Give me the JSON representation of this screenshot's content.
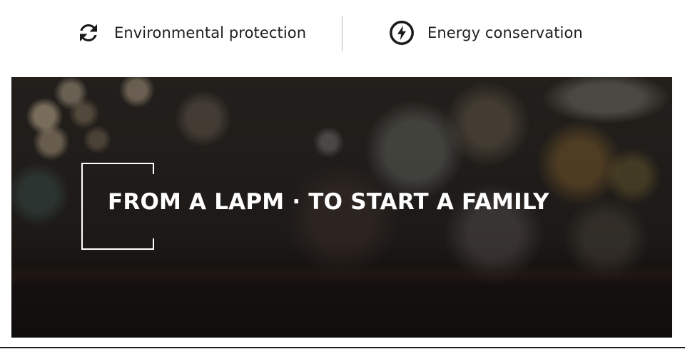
{
  "features": [
    {
      "label": "Environmental protection",
      "icon": "refresh-arrows-icon"
    },
    {
      "label": "Energy conservation",
      "icon": "lightning-bolt-icon"
    }
  ],
  "banner": {
    "headline": "FROM A LAPM · TO START A FAMILY"
  },
  "colors": {
    "icon": "#1a1a1a",
    "text": "#1e1e1e",
    "divider": "#bdbdbd",
    "headline": "#ffffff"
  }
}
